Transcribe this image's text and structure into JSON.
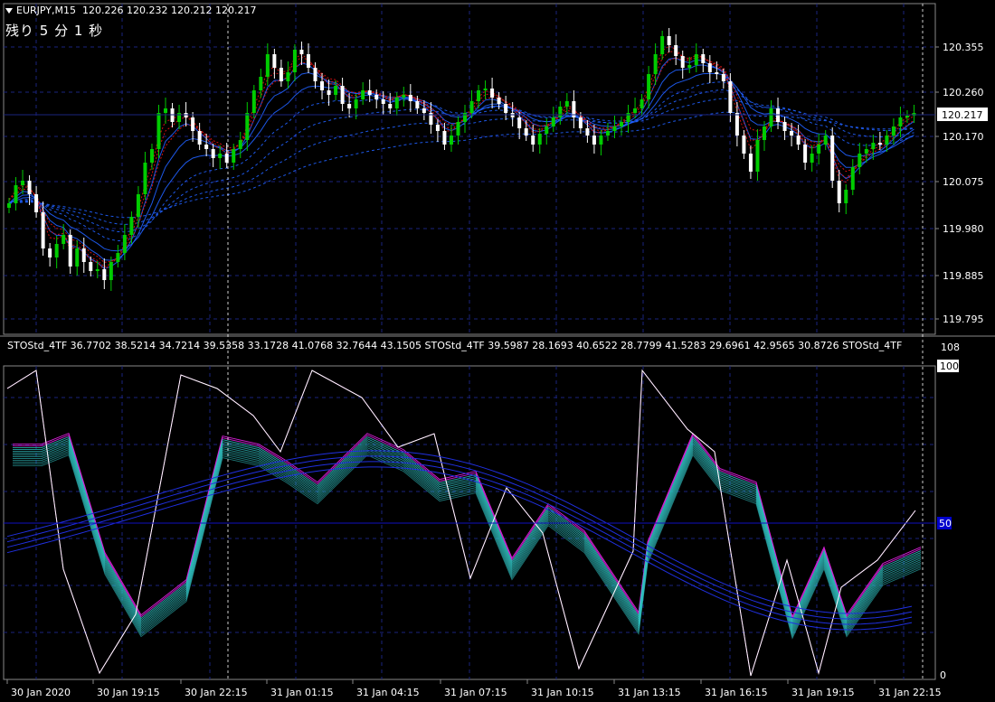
{
  "header": {
    "symbol": "EURJPY,M15",
    "open": "120.226",
    "high": "120.232",
    "low": "120.212",
    "close": "120.217"
  },
  "countdown": "残り 5 分 1 秒",
  "indicator": {
    "header_text": "STOStd_4TF 36.7702 38.5214 34.7214 39.5358 33.1728 41.0768 32.7644 43.1505   STOStd_4TF 39.5987 28.1693 40.6522 28.7799 41.5283 29.6961 42.9565 30.8726   STOStd_4TF",
    "scale_max_label": "108",
    "level_100": "100",
    "level_50": "50",
    "level_0": "0"
  },
  "price_axis": {
    "labels": [
      "120.355",
      "120.260",
      "120.170",
      "120.075",
      "119.980",
      "119.885",
      "119.795"
    ],
    "current_price": "120.217"
  },
  "time_axis": {
    "labels": [
      "30 Jan 2020",
      "30 Jan 19:15",
      "30 Jan 22:15",
      "31 Jan 01:15",
      "31 Jan 04:15",
      "31 Jan 07:15",
      "31 Jan 10:15",
      "31 Jan 13:15",
      "31 Jan 16:15",
      "31 Jan 19:15",
      "31 Jan 22:15"
    ]
  },
  "colors": {
    "bull": "#00cc00",
    "bear": "#ffffff",
    "grid": "#1a237e",
    "ma_red": "#d01010",
    "ma_blue": "#2060ff",
    "stoch_magenta": "#e020e0",
    "stoch_cyan": "#30c0c0",
    "stoch_blue": "#2030e0",
    "level_line": "#0000cc"
  }
}
